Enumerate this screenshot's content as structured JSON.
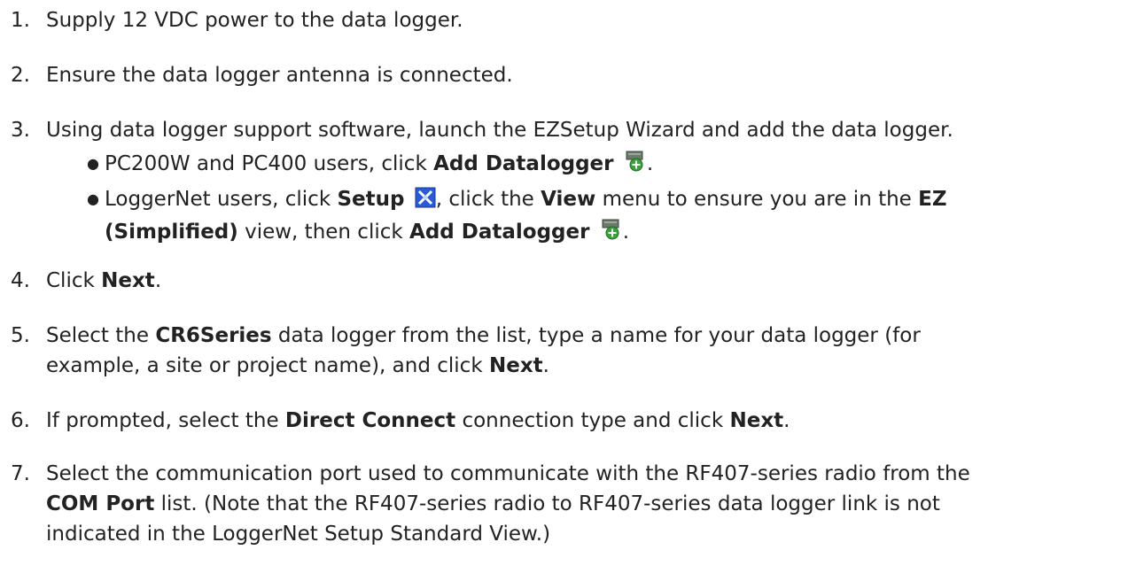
{
  "steps": [
    {
      "num": "1.",
      "parts": [
        "Supply 12 VDC power to the data logger."
      ]
    },
    {
      "num": "2.",
      "parts": [
        "Ensure the data logger antenna is connected."
      ]
    },
    {
      "num": "3.",
      "parts": [
        "Using data logger support software, launch the EZSetup Wizard and add the data logger."
      ]
    },
    {
      "num": "4.",
      "a": "Click ",
      "b": "Next",
      "c": "."
    },
    {
      "num": "5.",
      "a": "Select the ",
      "b": "CR6Series",
      "c": " data logger from the list, type a name for your data logger (for",
      "line2a": "example, a site or project name), and click ",
      "line2b": "Next",
      "line2c": "."
    },
    {
      "num": "6.",
      "a": "If prompted, select the ",
      "b": "Direct Connect",
      "c": " connection type and click ",
      "d": "Next",
      "e": "."
    },
    {
      "num": "7.",
      "a": "Select the communication port used to communicate with the RF407-series radio from the",
      "line2b": "COM Port",
      "line2c": " list. (Note that the RF407-series radio to RF407-series data logger link is not",
      "line3": "indicated in the LoggerNet Setup Standard View.)"
    }
  ],
  "bullets": {
    "b1": {
      "a": "PC200W and PC400 users, click ",
      "b": "Add Datalogger",
      "c": "."
    },
    "b2": {
      "a": "LoggerNet users, click ",
      "b": "Setup",
      "c": ", click the ",
      "d": "View",
      "e": " menu to ensure you are in the ",
      "f": "EZ",
      "line2a": "(Simplified)",
      "line2b": " view, then click ",
      "line2c": "Add Datalogger",
      "line2d": "."
    }
  },
  "icons": {
    "add_datalogger": "add-datalogger-icon",
    "setup": "setup-icon"
  }
}
